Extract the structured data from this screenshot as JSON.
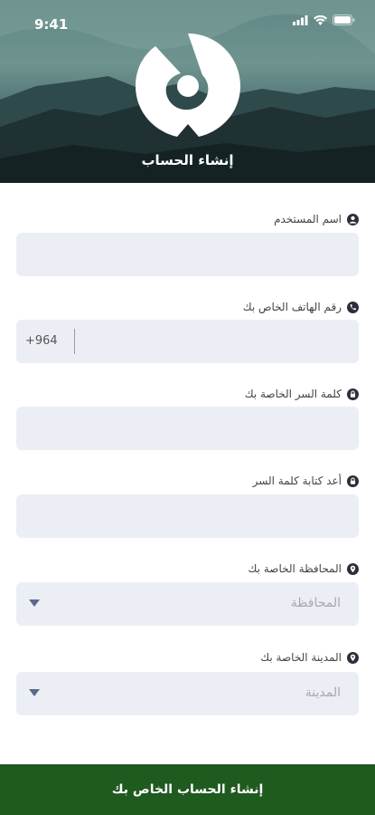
{
  "status_bar": {
    "time": "9:41"
  },
  "header": {
    "title": "إنشاء الحساب",
    "logo_icon": "brand-logo-icon"
  },
  "form": {
    "username": {
      "label": "اسم المستخدم",
      "icon": "user-icon",
      "value": ""
    },
    "phone": {
      "label": "رقم الهاتف الخاص بك",
      "icon": "phone-icon",
      "prefix": "+964",
      "value": ""
    },
    "password": {
      "label": "كلمة السر الخاصة بك",
      "icon": "lock-icon",
      "value": ""
    },
    "confirm_password": {
      "label": "أعد كتابة كلمة السر",
      "icon": "lock-icon",
      "value": ""
    },
    "governorate": {
      "label": "المحافظة الخاصة بك",
      "icon": "location-pin-icon",
      "placeholder": "المحافظة"
    },
    "city": {
      "label": "المدينة الخاصة بك",
      "icon": "location-pin-icon",
      "placeholder": "المدينة"
    }
  },
  "submit": {
    "label": "إنشاء الحساب الخاص بك"
  },
  "colors": {
    "primary": "#1f5a1f",
    "input_bg": "#eceef5"
  }
}
